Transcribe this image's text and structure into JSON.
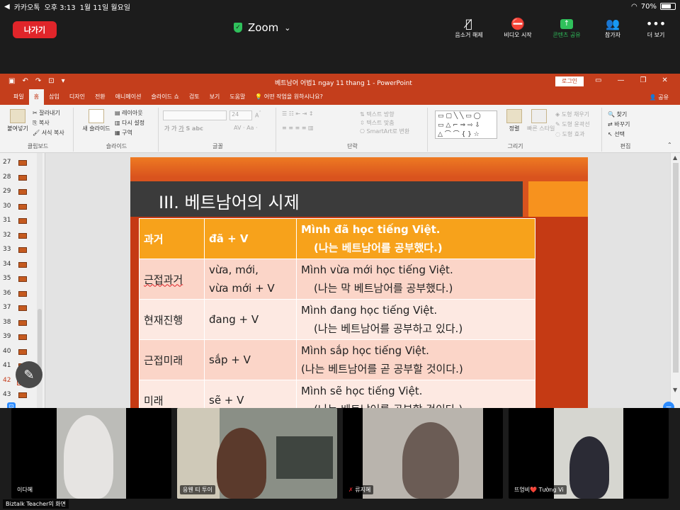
{
  "status_bar": {
    "carrier": "카카오톡",
    "time": "오후 3:13",
    "date": "1월 11일 월요일",
    "battery": "70%",
    "battery_level": 0.7
  },
  "zoom_bar": {
    "leave_label": "나가기",
    "title": "Zoom",
    "controls": [
      {
        "label": "음소거 해제",
        "icon": "mic-muted-icon"
      },
      {
        "label": "비디오 시작",
        "icon": "video-off-icon"
      },
      {
        "label": "콘텐츠 공유",
        "icon": "share-screen-icon"
      },
      {
        "label": "참가자",
        "icon": "participants-icon"
      },
      {
        "label": "더 보기",
        "icon": "more-icon"
      }
    ],
    "accent": "#2fc05b",
    "leave_color": "#e0252a"
  },
  "powerpoint": {
    "doc_title": "베트남어 어법1 ngay 11 thang 1  -  PowerPoint",
    "login_label": "로그인",
    "tabs": [
      "파일",
      "홈",
      "삽입",
      "디자인",
      "전환",
      "애니메이션",
      "슬라이드 쇼",
      "검토",
      "보기",
      "도움말",
      "어떤 작업을 원하시나요?"
    ],
    "active_tab": "홈",
    "share_label": "공유",
    "ribbon": {
      "clipboard": {
        "paste": "붙여넣기",
        "cut": "잘라내기",
        "copy": "복사",
        "format_painter": "서식 복사",
        "group": "클립보드"
      },
      "slides": {
        "new_slide": "새 슬라이드",
        "layout": "레이아웃",
        "reset": "다시 설정",
        "section": "구역",
        "group": "슬라이드"
      },
      "font": {
        "group": "글꼴",
        "size": "24"
      },
      "paragraph": {
        "text_direction": "텍스트 방향",
        "align_text": "텍스트 맞춤",
        "smartart": "SmartArt로 변환",
        "group": "단락"
      },
      "drawing": {
        "arrange": "정렬",
        "quick_styles": "빠른 스타일",
        "fill": "도형 채우기",
        "outline": "도형 윤곽선",
        "effects": "도형 효과",
        "group": "그리기"
      },
      "editing": {
        "find": "찾기",
        "replace": "바꾸기",
        "select": "선택",
        "group": "편집"
      }
    },
    "slide_numbers": [
      "27",
      "28",
      "29",
      "30",
      "31",
      "32",
      "33",
      "34",
      "35",
      "36",
      "37",
      "38",
      "39",
      "40",
      "41",
      "42",
      "43"
    ],
    "current_slide": "42",
    "brand_color": "#c43e1c"
  },
  "slide": {
    "title": "III. 베트남어의 시제",
    "rows": [
      {
        "tense": "과거",
        "form": [
          "đã + V"
        ],
        "example": "Mình đã học tiếng Việt.",
        "translation": "(나는 베트남어를 공부했다.)"
      },
      {
        "tense": "근접과거",
        "form": [
          "vừa, mới,",
          "vừa mới + V"
        ],
        "example": "Mình vừa mới học tiếng Việt.",
        "translation": "(나는 막 베트남어를 공부했다.)"
      },
      {
        "tense": "현재진행",
        "form": [
          "đang + V"
        ],
        "example": "Mình đang học tiếng Việt.",
        "translation": "(나는 베트남어를 공부하고 있다.)"
      },
      {
        "tense": "근접미래",
        "form": [
          "sắp + V"
        ],
        "example": "Mình sắp học tiếng Việt.",
        "translation": "(나는 베트남어를 곧 공부할 것이다.)"
      },
      {
        "tense": "미래",
        "form": [
          "sẽ + V"
        ],
        "example": "Mình sẽ học tiếng Việt.",
        "translation": "(나는 베트남어를 공부할 것이다.)"
      }
    ]
  },
  "participants": [
    {
      "name": "이다혜"
    },
    {
      "name": "응웬 티 투이"
    },
    {
      "name": "류지혜"
    },
    {
      "name": "뜨엉비❤️ Tường Vi"
    }
  ],
  "screen_share_label": "Biztalk Teacher의 화면"
}
